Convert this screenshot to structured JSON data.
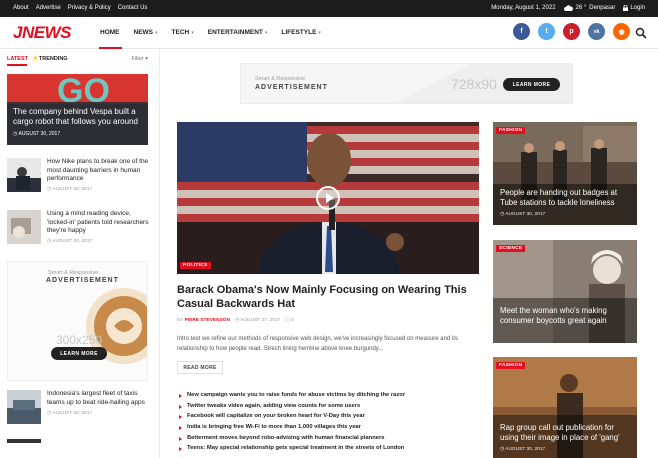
{
  "topbar": {
    "nav": [
      "About",
      "Advertise",
      "Privacy & Policy",
      "Contact Us"
    ],
    "date": "Monday, August 1, 2022",
    "weather": "26 °",
    "city": "Denpasar",
    "login": "Login"
  },
  "header": {
    "logo": "JNEWS",
    "nav": [
      {
        "label": "HOME",
        "caret": "▾"
      },
      {
        "label": "NEWS",
        "caret": "▾"
      },
      {
        "label": "TECH",
        "caret": "▾"
      },
      {
        "label": "ENTERTAINMENT",
        "caret": "▾"
      },
      {
        "label": "LIFESTYLE",
        "caret": "▾"
      }
    ],
    "social": [
      {
        "icon": "facebook-icon",
        "glyph": "f",
        "color": "#3b5998"
      },
      {
        "icon": "twitter-icon",
        "glyph": "t",
        "color": "#55acee"
      },
      {
        "icon": "pinterest-icon",
        "glyph": "p",
        "color": "#cb2027"
      },
      {
        "icon": "vk-icon",
        "glyph": "vk",
        "color": "#4c75a3"
      },
      {
        "icon": "rss-icon",
        "glyph": "◉",
        "color": "#ff6600"
      }
    ]
  },
  "left": {
    "tab_latest": "LATEST",
    "tab_trending": "TRENDING",
    "filter": "Filter",
    "featured": {
      "title": "The company behind Vespa built a cargo robot that follows you around",
      "date": "AUGUST 30, 2017"
    },
    "items": [
      {
        "title": "How Nike plans to break one of the most daunting barriers in human performance",
        "date": "AUGUST 30, 2017"
      },
      {
        "title": "Using a mind reading device, 'locked-in' patients told researchers they're happy",
        "date": "AUGUST 30, 2017"
      }
    ],
    "ad": {
      "small": "Smart & Responsive",
      "big": "ADVERTISEMENT",
      "size": "300x250",
      "button": "LEARN MORE"
    },
    "bottom_item": {
      "title": "Indonesia's largest fleet of taxis teams up to beat ride-hailing apps",
      "date": "AUGUST 30, 2017"
    }
  },
  "top_ad": {
    "small": "Smart & Responsive",
    "big": "ADVERTISEMENT",
    "size": "728x90",
    "button": "LEARN MORE"
  },
  "center": {
    "category": "POLITICS",
    "title": "Barack Obama's Now Mainly Focusing on Wearing This Casual Backwards Hat",
    "by": "BY",
    "author": "PIERE STEVENSON",
    "date": "AUGUST 27, 2017",
    "comments": "0",
    "excerpt": "Intro text we refine our methods of responsive web design, we've increasingly focused on measure and its relationship to how people read. Strech lining hemline above knee burgundy...",
    "read_more": "READ MORE",
    "headlines": [
      "New campaign wants you to raise funds for abuse victims by ditching the razor",
      "Twitter tweaks video again, adding view counts for some users",
      "Facebook will capitalize on your broken heart for V-Day this year",
      "India is bringing free Wi-Fi to more than 1,000 villages this year",
      "Betterment moves beyond robo-advising with human financial planners",
      "Teens: May special relationship gets special treatment in the streets of London"
    ]
  },
  "right": [
    {
      "category": "FASHION",
      "title": "People are handing out badges at Tube stations to tackle loneliness",
      "date": "AUGUST 30, 2017"
    },
    {
      "category": "SCIENCE",
      "title": "Meet the woman who's making consumer boycotts great again",
      "date": "AUGUST 30, 2017"
    },
    {
      "category": "FASHION",
      "title": "Rap group call out publication for using their image in place of 'gang'",
      "date": "AUGUST 30, 2017"
    }
  ]
}
